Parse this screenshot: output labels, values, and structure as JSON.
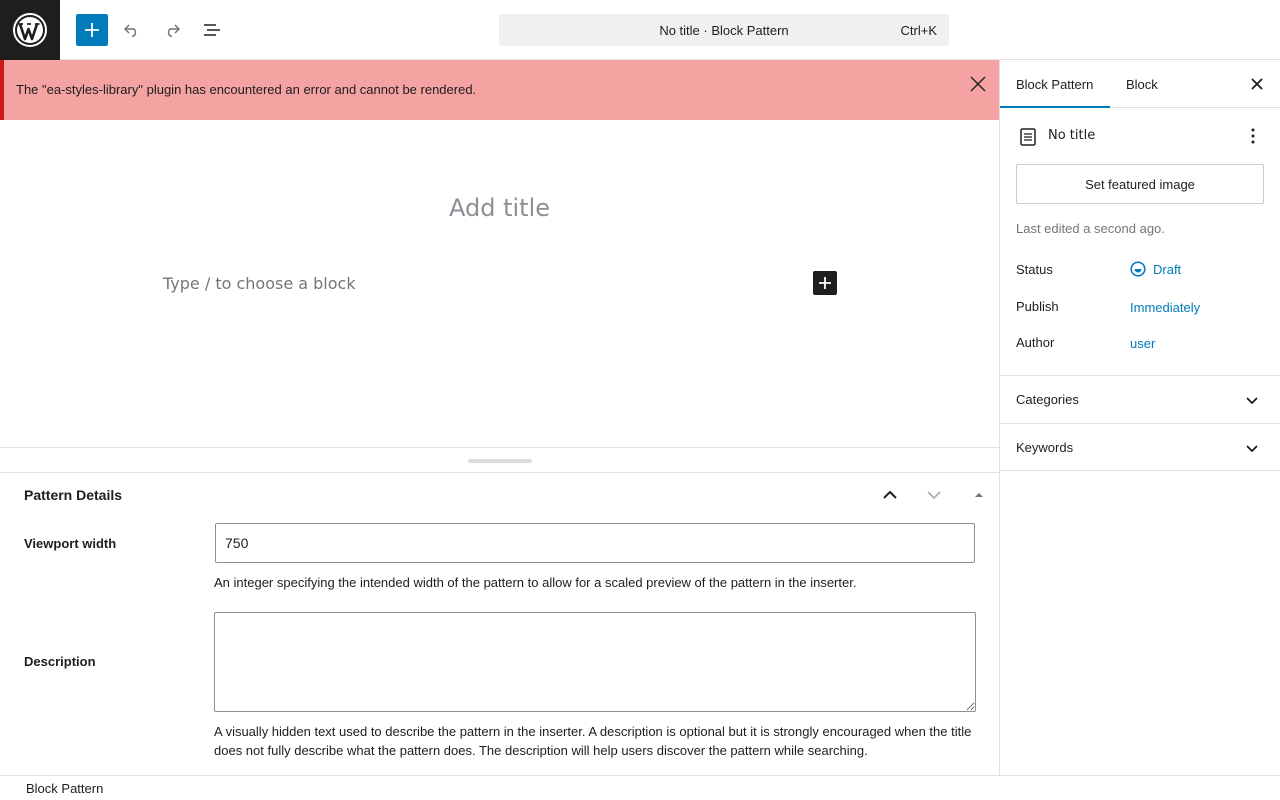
{
  "topbar": {
    "logo_icon": "wordpress-logo-icon",
    "inserter_icon": "plus-icon",
    "undo_icon": "undo-icon",
    "redo_icon": "redo-icon",
    "list_view_icon": "list-view-icon",
    "command_title": "No title · Block Pattern",
    "command_shortcut": "Ctrl+K"
  },
  "notice": {
    "message": "The \"ea-styles-library\" plugin has encountered an error and cannot be rendered.",
    "close_icon": "close-icon"
  },
  "canvas": {
    "title_placeholder": "Add title",
    "block_placeholder": "Type / to choose a block"
  },
  "pattern_details": {
    "title": "Pattern Details",
    "viewport_label": "Viewport width",
    "viewport_value": "750",
    "viewport_help": "An integer specifying the intended width of the pattern to allow for a scaled preview of the pattern in the inserter.",
    "description_label": "Description",
    "description_value": "",
    "description_help": "A visually hidden text used to describe the pattern in the inserter. A description is optional but it is strongly encouraged when the title does not fully describe what the pattern does. The description will help users discover the pattern while searching."
  },
  "sidebar": {
    "tabs": [
      {
        "label": "Block Pattern",
        "active": true
      },
      {
        "label": "Block",
        "active": false
      }
    ],
    "post_title": "No title",
    "featured_image_label": "Set featured image",
    "last_edited": "Last edited a second ago.",
    "rows": {
      "status_label": "Status",
      "status_value": "Draft",
      "publish_label": "Publish",
      "publish_value": "Immediately",
      "author_label": "Author",
      "author_value": "user"
    },
    "panels": [
      {
        "label": "Categories"
      },
      {
        "label": "Keywords"
      }
    ]
  },
  "footer": {
    "breadcrumb": "Block Pattern"
  },
  "colors": {
    "accent": "#007cba",
    "notice_bg": "#f4a2a2",
    "notice_border": "#cc1818"
  }
}
